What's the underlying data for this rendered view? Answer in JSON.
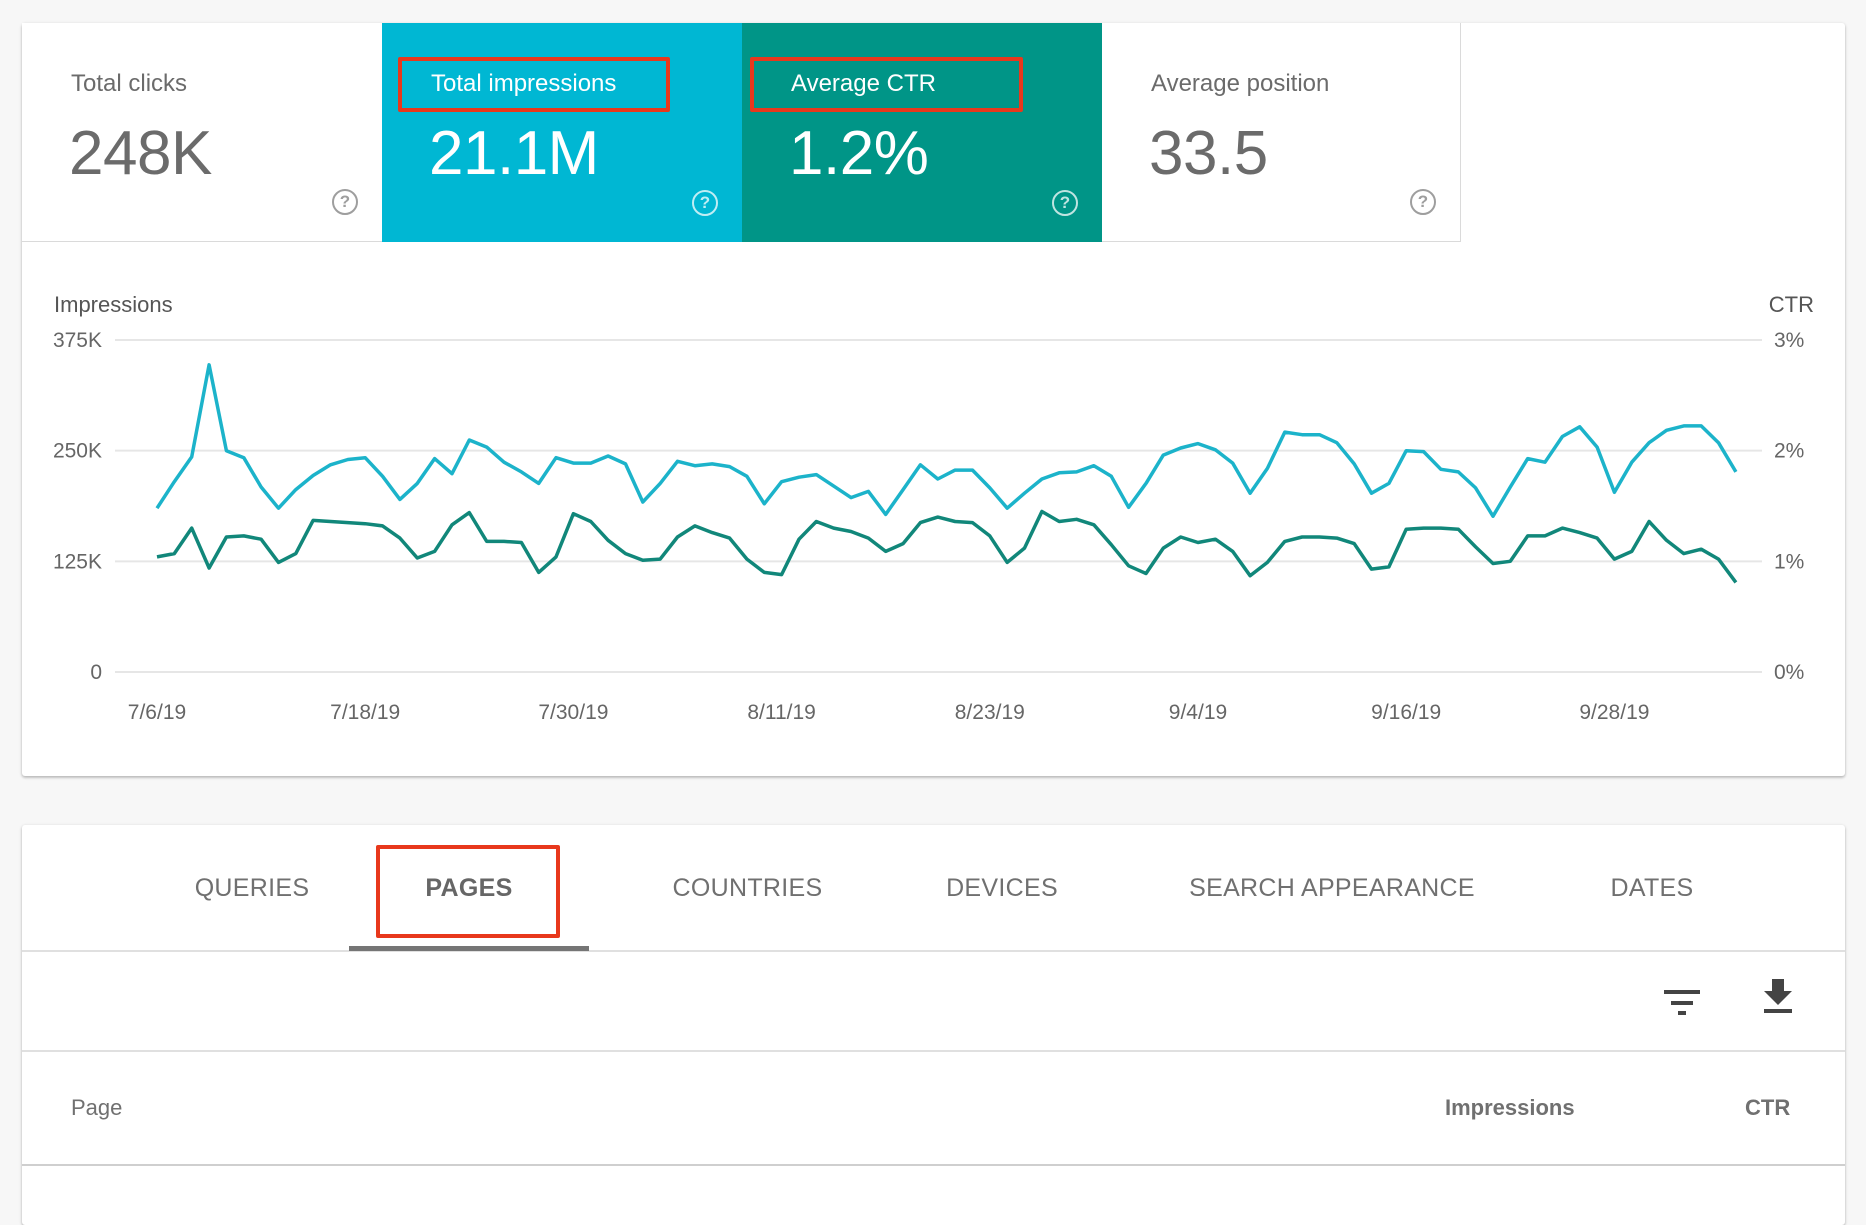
{
  "metrics": [
    {
      "label": "Total clicks",
      "value": "248K",
      "selected": false
    },
    {
      "label": "Total impressions",
      "value": "21.1M",
      "selected": true,
      "color": "#00b7d3"
    },
    {
      "label": "Average CTR",
      "value": "1.2%",
      "selected": true,
      "color": "#009587"
    },
    {
      "label": "Average position",
      "value": "33.5",
      "selected": false
    }
  ],
  "help_icon": "?",
  "annotation_color": "#e8381c",
  "chart_data": {
    "type": "line",
    "title": "",
    "left_axis_title": "Impressions",
    "right_axis_title": "CTR",
    "left_ticks": [
      "0",
      "125K",
      "250K",
      "375K"
    ],
    "right_ticks": [
      "0%",
      "1%",
      "2%",
      "3%"
    ],
    "left_ylim": [
      0,
      375000
    ],
    "right_ylim": [
      0,
      3
    ],
    "x_start": "7/6/19",
    "x_end": "10/5/19",
    "x_tick_labels": [
      "7/6/19",
      "7/18/19",
      "7/30/19",
      "8/11/19",
      "8/23/19",
      "9/4/19",
      "9/16/19",
      "9/28/19"
    ],
    "x_tick_interval_days": 12,
    "grid": true,
    "series": [
      {
        "name": "Impressions",
        "axis": "left",
        "color": "#1cb3ca",
        "values": [
          185000,
          215000,
          243000,
          347000,
          250000,
          242000,
          209000,
          185000,
          206000,
          222000,
          234000,
          240000,
          242000,
          221000,
          195000,
          213000,
          241000,
          224000,
          262000,
          254000,
          237000,
          226000,
          213000,
          242000,
          236000,
          236000,
          244000,
          235000,
          192000,
          213000,
          238000,
          233000,
          235000,
          232000,
          221000,
          190000,
          215000,
          220000,
          223000,
          210000,
          197000,
          204000,
          178000,
          206000,
          234000,
          218000,
          228000,
          228000,
          208000,
          185000,
          202000,
          218000,
          225000,
          226000,
          233000,
          221000,
          186000,
          213000,
          245000,
          253000,
          258000,
          251000,
          236000,
          202000,
          230000,
          271000,
          268000,
          268000,
          259000,
          235000,
          202000,
          213000,
          250000,
          249000,
          229000,
          226000,
          208000,
          176000,
          209000,
          241000,
          237000,
          266000,
          277000,
          254000,
          203000,
          237000,
          259000,
          273000,
          278000,
          278000,
          259000,
          226000
        ]
      },
      {
        "name": "CTR",
        "axis": "right",
        "color": "#11877a",
        "values": [
          1.04,
          1.07,
          1.3,
          0.94,
          1.22,
          1.23,
          1.2,
          0.99,
          1.07,
          1.37,
          1.36,
          1.35,
          1.34,
          1.32,
          1.21,
          1.03,
          1.09,
          1.33,
          1.44,
          1.18,
          1.18,
          1.17,
          0.9,
          1.04,
          1.43,
          1.36,
          1.19,
          1.07,
          1.01,
          1.02,
          1.22,
          1.32,
          1.26,
          1.21,
          1.02,
          0.9,
          0.88,
          1.2,
          1.36,
          1.3,
          1.27,
          1.21,
          1.09,
          1.16,
          1.35,
          1.4,
          1.36,
          1.35,
          1.23,
          0.99,
          1.12,
          1.45,
          1.36,
          1.38,
          1.33,
          1.15,
          0.96,
          0.89,
          1.12,
          1.22,
          1.17,
          1.2,
          1.09,
          0.87,
          0.99,
          1.18,
          1.22,
          1.22,
          1.21,
          1.16,
          0.93,
          0.95,
          1.29,
          1.3,
          1.3,
          1.29,
          1.13,
          0.98,
          1.0,
          1.23,
          1.23,
          1.3,
          1.26,
          1.21,
          1.02,
          1.09,
          1.36,
          1.19,
          1.07,
          1.11,
          1.02,
          0.81
        ]
      }
    ]
  },
  "tabs": [
    {
      "label": "QUERIES",
      "active": false
    },
    {
      "label": "PAGES",
      "active": true
    },
    {
      "label": "COUNTRIES",
      "active": false
    },
    {
      "label": "DEVICES",
      "active": false
    },
    {
      "label": "SEARCH APPEARANCE",
      "active": false
    },
    {
      "label": "DATES",
      "active": false
    }
  ],
  "toolbar": {
    "filter_icon": "filter-icon",
    "download_icon": "download-icon"
  },
  "table": {
    "columns": [
      "Page",
      "Impressions",
      "CTR"
    ]
  }
}
